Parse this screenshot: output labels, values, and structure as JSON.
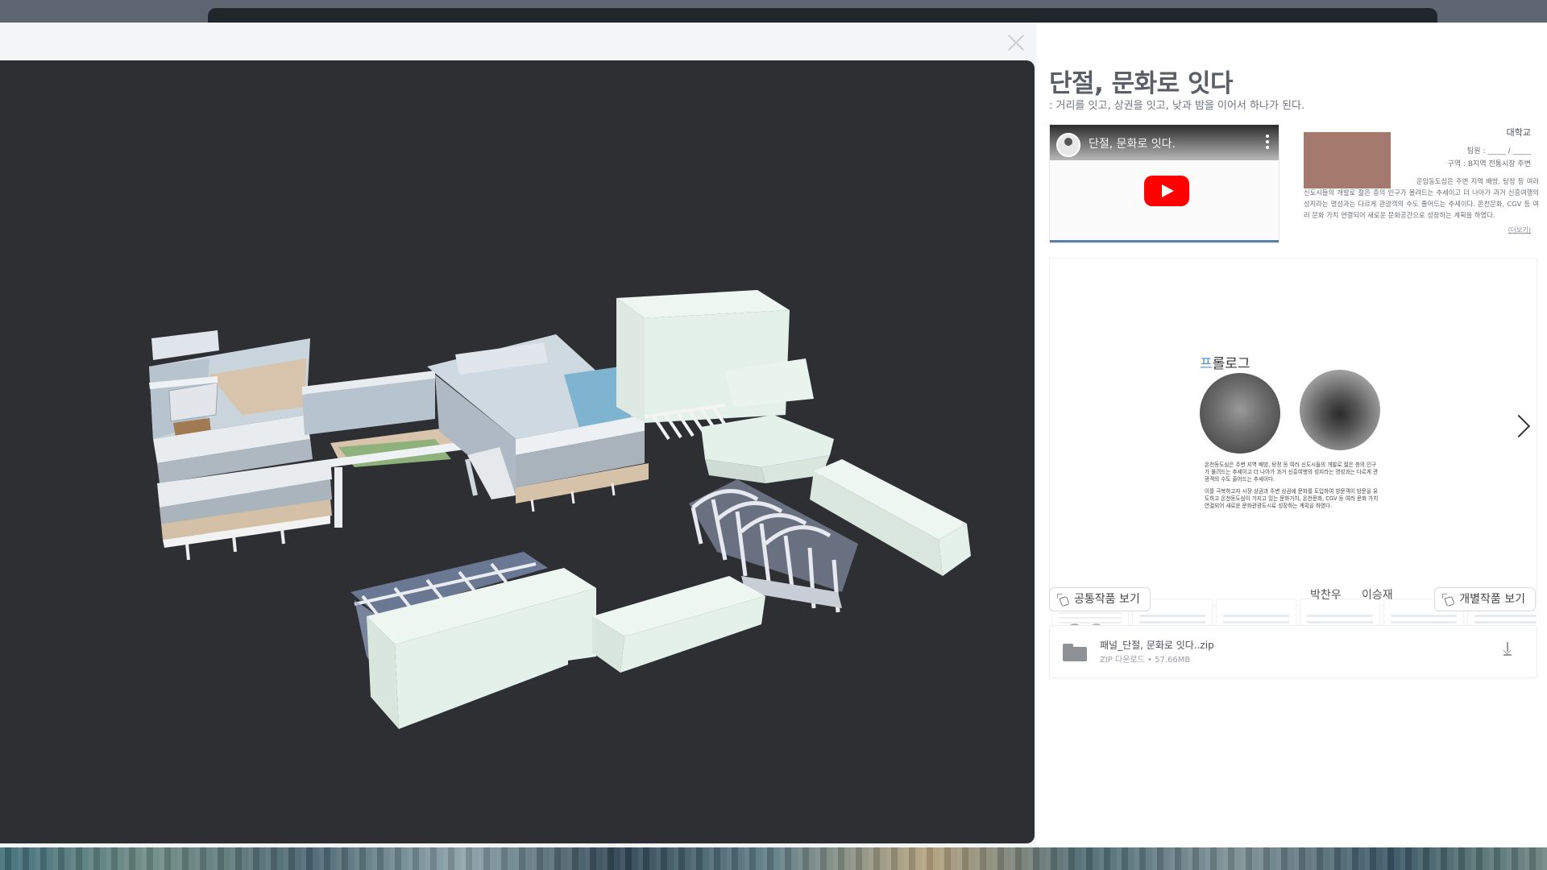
{
  "project": {
    "title": "단절, 문화로 잇다",
    "subtitle": ": 거리를 잇고, 상권을 잇고, 낮과 밤을 이어서 하나가 된다."
  },
  "video": {
    "title": "단절, 문화로 잇다."
  },
  "info": {
    "school": "대학교",
    "team": "팀원 : _____ / _____",
    "area": "구역 : B지역 전통시장 주변",
    "description": "운암동도심은 주변 지역 배방, 탕정 등 여러 신도시들의 개발로 젊은 층의 인구가 몰려드는 추세이고 더 나아가 과거 신흥여행의 성지라는 명성과는 다르게 관광객의 수도 줄어드는 추세이다. 온천문화, CGV 등 여러 문화 가치 연결되어 새로운 문화공간으로 성장하는 계획을 하였다.",
    "more_label": "(더보기)"
  },
  "slide": {
    "title_first": "프",
    "title_rest": "롤로그",
    "paragraph1": "온천동도심은 주변 지역 배방, 탕정 등 여러 신도시들의 개발로 젊은 층의 인구가 몰려드는 추세이고 더 나아가 과거 신흥여행의 성지라는 명성과는 다르게 관광객의 수도 줄어드는 추세이다.",
    "paragraph2": "이를 극복하고자 시장 상권과 주변 상권에 문화를 도입하여 방문객이 방문을 유도하고 온천동도심이 가지고 있는 문화가치, 온천문화, CGV 등 여러 문화 가치 연결되어 새로운 문화관광도시로 성장하는 계획을 하였다."
  },
  "actions": {
    "common_works": "공통작품 보기",
    "individual_works": "개별작품 보기",
    "members": [
      "박찬우",
      "이승재"
    ]
  },
  "download": {
    "filename": "패널_단절, 문화로 잇다..zip",
    "meta": "ZIP 다운로드 • 57.66MB"
  },
  "colors": {
    "viewer_bg": "#2d2f33",
    "building_mint": "#e4f1ea",
    "accent_blue": "#4f8fd4",
    "thumb_color": "#a57a6e",
    "youtube_red": "#ff0000"
  }
}
